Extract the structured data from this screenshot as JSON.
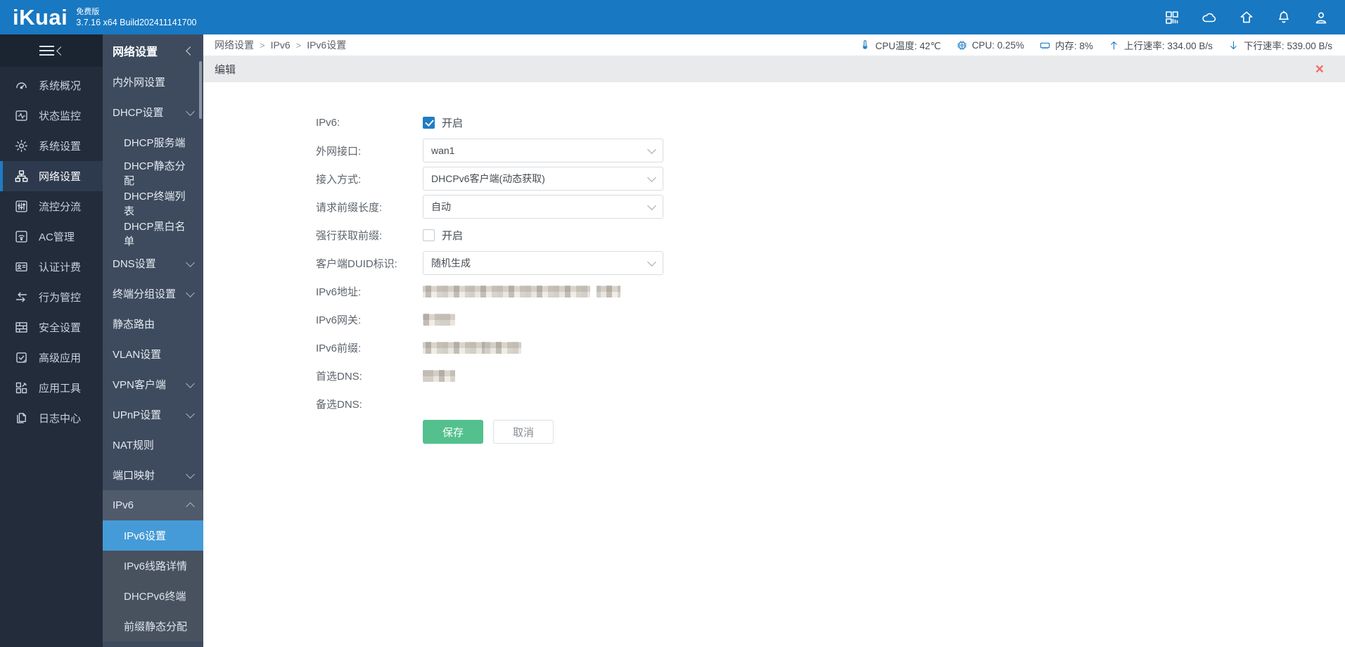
{
  "header": {
    "logo": "iKuai",
    "edition": "免费版",
    "version": "3.7.16 x64 Build202411141700",
    "icons": [
      {
        "name": "apps-icon"
      },
      {
        "name": "cloud-icon"
      },
      {
        "name": "home-icon"
      },
      {
        "name": "bell-icon"
      },
      {
        "name": "user-icon"
      }
    ]
  },
  "sidebar": {
    "items": [
      {
        "label": "系统概况",
        "icon": "gauge",
        "active": false
      },
      {
        "label": "状态监控",
        "icon": "monitor",
        "active": false
      },
      {
        "label": "系统设置",
        "icon": "gear",
        "active": false
      },
      {
        "label": "网络设置",
        "icon": "network",
        "active": true
      },
      {
        "label": "流控分流",
        "icon": "sliders",
        "active": false
      },
      {
        "label": "AC管理",
        "icon": "wifi",
        "active": false
      },
      {
        "label": "认证计费",
        "icon": "idcard",
        "active": false
      },
      {
        "label": "行为管控",
        "icon": "arrows",
        "active": false
      },
      {
        "label": "安全设置",
        "icon": "wall",
        "active": false
      },
      {
        "label": "高级应用",
        "icon": "doc-check",
        "active": false
      },
      {
        "label": "应用工具",
        "icon": "app-tools",
        "active": false
      },
      {
        "label": "日志中心",
        "icon": "logs",
        "active": false
      }
    ]
  },
  "submenu": {
    "title": "网络设置",
    "items": [
      {
        "label": "内外网设置"
      },
      {
        "label": "DHCP设置",
        "chevron": "down"
      },
      {
        "label": "DHCP服务端",
        "child": true
      },
      {
        "label": "DHCP静态分配",
        "child": true
      },
      {
        "label": "DHCP终端列表",
        "child": true
      },
      {
        "label": "DHCP黑白名单",
        "child": true
      },
      {
        "label": "DNS设置",
        "chevron": "down"
      },
      {
        "label": "终端分组设置",
        "chevron": "down"
      },
      {
        "label": "静态路由"
      },
      {
        "label": "VLAN设置"
      },
      {
        "label": "VPN客户端",
        "chevron": "down"
      },
      {
        "label": "UPnP设置",
        "chevron": "down"
      },
      {
        "label": "NAT规则"
      },
      {
        "label": "端口映射",
        "chevron": "down"
      },
      {
        "label": "IPv6",
        "chevron": "up",
        "open": true
      },
      {
        "label": "IPv6设置",
        "child": true,
        "section": true,
        "selected": true
      },
      {
        "label": "IPv6线路详情",
        "child": true,
        "section": true
      },
      {
        "label": "DHCPv6终端",
        "child": true,
        "section": true
      },
      {
        "label": "前缀静态分配",
        "child": true,
        "section": true
      }
    ]
  },
  "breadcrumb": {
    "separator": ">",
    "items": [
      "网络设置",
      "IPv6",
      "IPv6设置"
    ]
  },
  "status": {
    "items": [
      {
        "icon": "thermometer-icon",
        "text": "CPU温度: 42℃"
      },
      {
        "icon": "cpu-icon",
        "text": "CPU: 0.25%"
      },
      {
        "icon": "memory-icon",
        "text": "内存: 8%"
      },
      {
        "icon": "arrow-up-icon",
        "text": "上行速率: 334.00 B/s"
      },
      {
        "icon": "arrow-down-icon",
        "text": "下行速率: 539.00 B/s"
      }
    ]
  },
  "panel": {
    "title": "编辑",
    "close_label": "×"
  },
  "form": {
    "rows": [
      {
        "label": "IPv6:",
        "type": "checkbox",
        "checked": true,
        "text": "开启"
      },
      {
        "label": "外网接口:",
        "type": "select",
        "value": "wan1"
      },
      {
        "label": "接入方式:",
        "type": "select",
        "value": "DHCPv6客户端(动态获取)"
      },
      {
        "label": "请求前缀长度:",
        "type": "select",
        "value": "自动"
      },
      {
        "label": "强行获取前缀:",
        "type": "checkbox",
        "checked": false,
        "text": "开启"
      },
      {
        "label": "客户端DUID标识:",
        "type": "select",
        "value": "随机生成"
      },
      {
        "label": "IPv6地址:",
        "type": "redacted",
        "blocks": [
          238,
          34
        ]
      },
      {
        "label": "IPv6网关:",
        "type": "redacted",
        "blocks": [
          46
        ]
      },
      {
        "label": "IPv6前缀:",
        "type": "redacted",
        "blocks": [
          140
        ]
      },
      {
        "label": "首选DNS:",
        "type": "redacted",
        "blocks": [
          46
        ]
      },
      {
        "label": "备选DNS:",
        "type": "empty"
      }
    ],
    "save_label": "保存",
    "cancel_label": "取消"
  },
  "colors": {
    "topbar_blue": "#1878c2",
    "accent_blue": "#1f7dc4",
    "selected_item_blue": "#459bd7",
    "save_green": "#53c08d",
    "close_red": "#f56c6c"
  }
}
